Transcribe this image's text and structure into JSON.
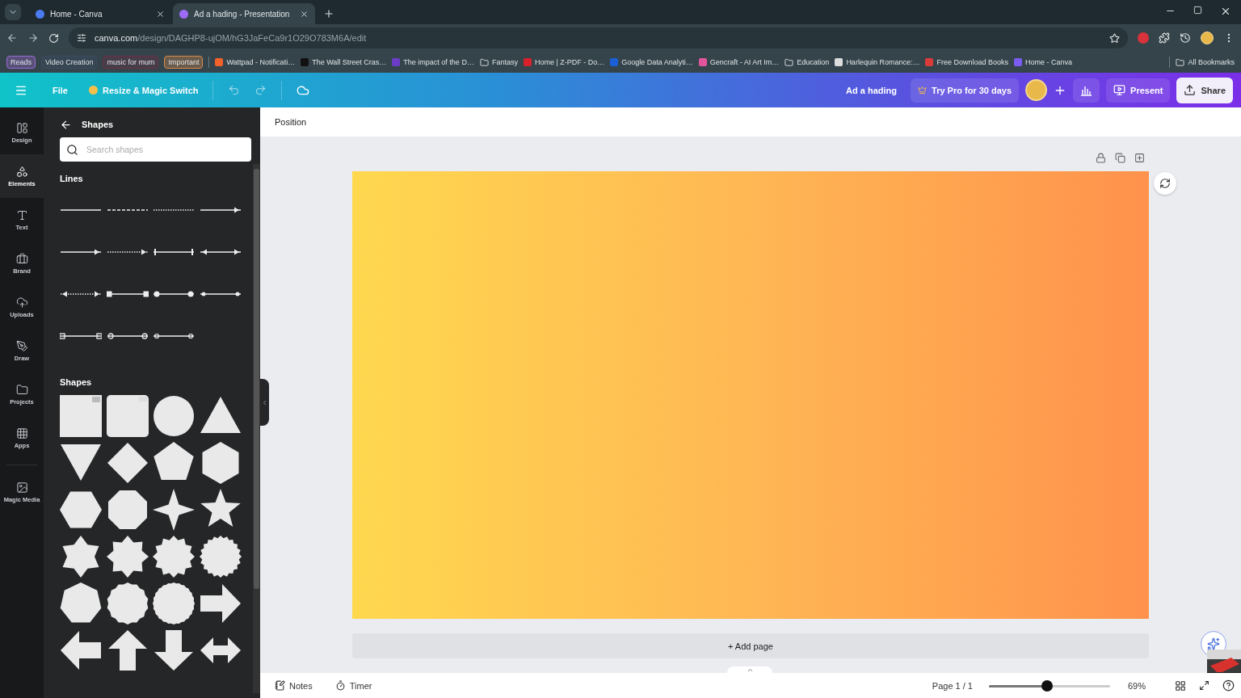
{
  "browser": {
    "tabs": [
      {
        "title": "Home - Canva",
        "selected": false
      },
      {
        "title": "Ad a hading - Presentation",
        "selected": true
      }
    ],
    "url": {
      "domain": "canva.com",
      "path": "/design/DAGHP8-ujOM/hG3JaFeCa9r1O29O783M6A/edit"
    },
    "bookmarks": [
      {
        "label": "Reads",
        "kind": "chip",
        "color": "#9b6ad6"
      },
      {
        "label": "Video Creation",
        "kind": "chip",
        "color": "#3d4a63"
      },
      {
        "label": "music for mum",
        "kind": "chip",
        "color": "#6b2f45"
      },
      {
        "label": "Important",
        "kind": "chip",
        "color": "#d98a4a"
      },
      {
        "label": "Wattpad - Notificati…",
        "kind": "link",
        "color": "#f2602b"
      },
      {
        "label": "The Wall Street Cras…",
        "kind": "link",
        "color": "#111111"
      },
      {
        "label": "The impact of the D…",
        "kind": "link",
        "color": "#6a3cc7"
      },
      {
        "label": "Fantasy",
        "kind": "folder"
      },
      {
        "label": "Home | Z-PDF - Do…",
        "kind": "link",
        "color": "#d8202a"
      },
      {
        "label": "Google Data Analyti…",
        "kind": "link",
        "color": "#1a5fd6"
      },
      {
        "label": "Gencraft - AI Art Im…",
        "kind": "link",
        "color": "#e0559b"
      },
      {
        "label": "Education",
        "kind": "folder"
      },
      {
        "label": "Harlequin Romance:…",
        "kind": "link",
        "color": "#dddddd"
      },
      {
        "label": "Free Download Books",
        "kind": "link",
        "color": "#d93a3a"
      },
      {
        "label": "Home - Canva",
        "kind": "link",
        "color": "#7b5cf0"
      }
    ],
    "all_bookmarks": "All Bookmarks"
  },
  "header": {
    "file": "File",
    "resize": "Resize & Magic Switch",
    "title": "Ad a hading",
    "pro": "Try Pro for 30 days",
    "present": "Present",
    "share": "Share"
  },
  "rail": [
    {
      "label": "Design",
      "selected": false
    },
    {
      "label": "Elements",
      "selected": true
    },
    {
      "label": "Text",
      "selected": false
    },
    {
      "label": "Brand",
      "selected": false
    },
    {
      "label": "Uploads",
      "selected": false
    },
    {
      "label": "Draw",
      "selected": false
    },
    {
      "label": "Projects",
      "selected": false
    },
    {
      "label": "Apps",
      "selected": false
    },
    {
      "label": "Magic Media",
      "selected": false
    }
  ],
  "panel": {
    "title": "Shapes",
    "search": {
      "placeholder": "Search shapes"
    },
    "lines_heading": "Lines",
    "shapes_heading": "Shapes"
  },
  "toolbar": {
    "label": "Position"
  },
  "add_page": "+ Add page",
  "footer": {
    "notes": "Notes",
    "timer": "Timer",
    "page": "Page 1 / 1",
    "zoom": {
      "level": 0.48,
      "reading": "69%"
    }
  }
}
